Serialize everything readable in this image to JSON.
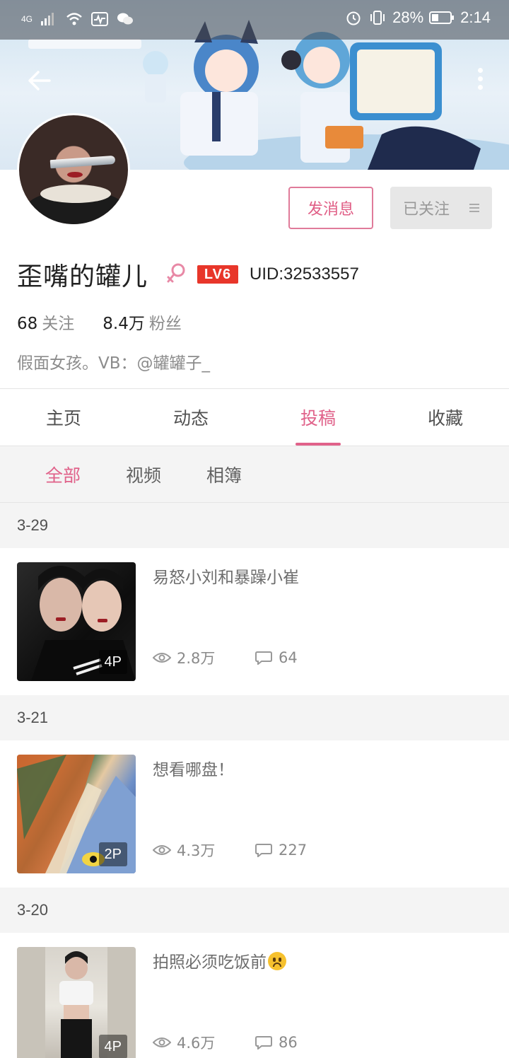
{
  "status_bar": {
    "network": "4G",
    "battery": "28%",
    "time": "2:14"
  },
  "profile": {
    "display_name": "歪嘴的罐儿",
    "level": "LV6",
    "uid": "UID:32533557",
    "following_count": "68",
    "following_label": "关注",
    "followers_count": "8.4万",
    "followers_label": "粉丝",
    "bio": "假面女孩。VB：@罐罐子_",
    "message_button": "发消息",
    "follow_button": "已关注"
  },
  "tabs": [
    {
      "label": "主页",
      "active": false
    },
    {
      "label": "动态",
      "active": false
    },
    {
      "label": "投稿",
      "active": true
    },
    {
      "label": "收藏",
      "active": false
    }
  ],
  "subtabs": [
    {
      "label": "全部",
      "active": true
    },
    {
      "label": "视频",
      "active": false
    },
    {
      "label": "相簿",
      "active": false
    }
  ],
  "posts": [
    {
      "date": "3-29",
      "title": "易怒小刘和暴躁小崔",
      "photos": "4P",
      "views": "2.8万",
      "comments": "64"
    },
    {
      "date": "3-21",
      "title": "想看哪盘！",
      "photos": "2P",
      "views": "4.3万",
      "comments": "227"
    },
    {
      "date": "3-20",
      "title": "拍照必须吃饭前",
      "photos": "4P",
      "views": "4.6万",
      "comments": "86"
    }
  ],
  "colors": {
    "accent": "#e0628a",
    "level_badge": "#e8362a"
  }
}
